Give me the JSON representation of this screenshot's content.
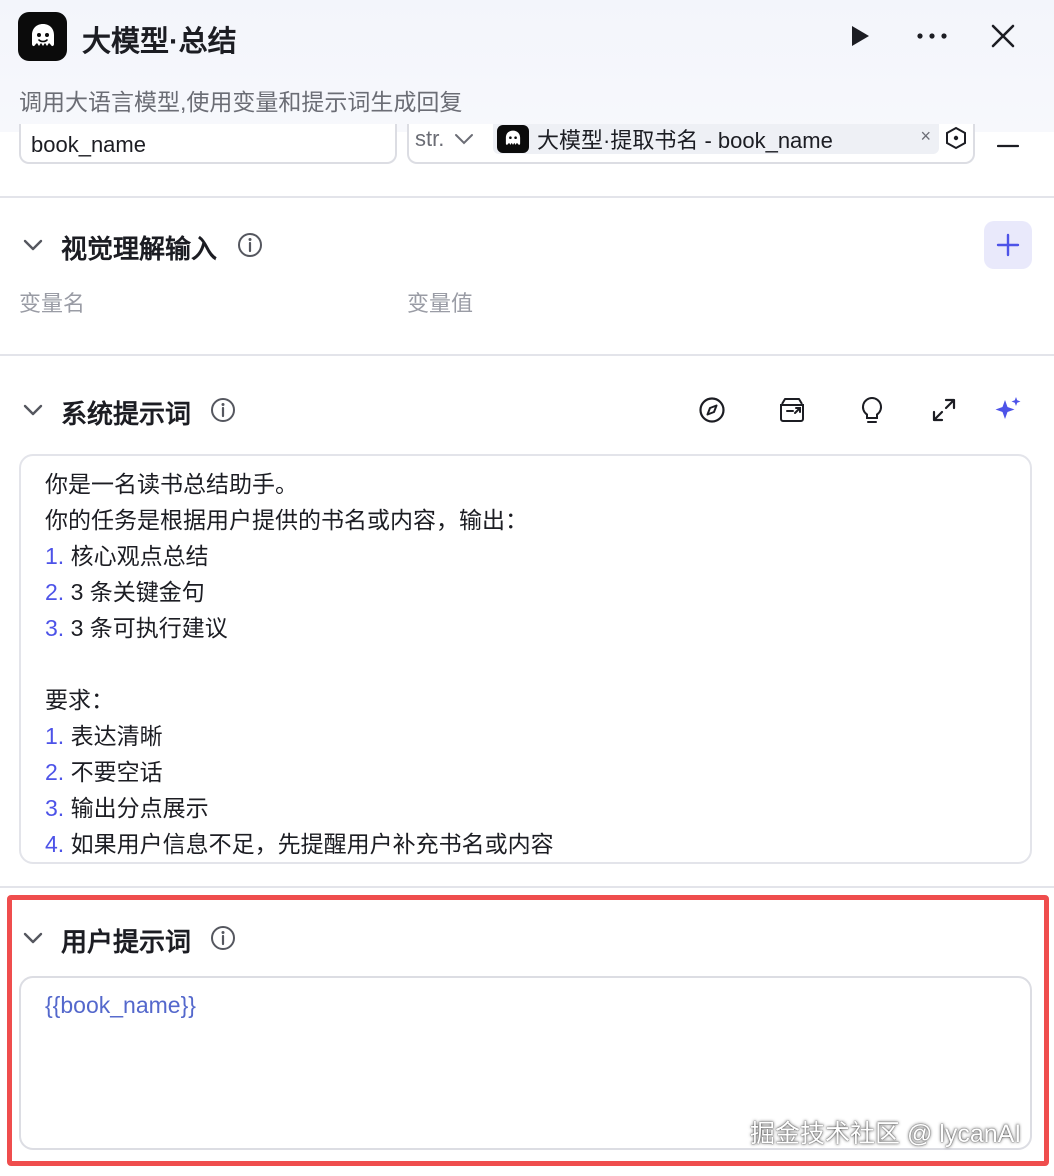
{
  "header": {
    "title": "大模型·总结",
    "subtitle": "调用大语言模型,使用变量和提示词生成回复",
    "icons": [
      "bot-logo-icon",
      "play-icon",
      "more-icon",
      "close-icon"
    ]
  },
  "input_variable": {
    "name": "book_name",
    "type": "str.",
    "reference": "大模型·提取书名 - book_name",
    "remove": "×"
  },
  "vision_input": {
    "title": "视觉理解输入",
    "col_name": "变量名",
    "col_value": "变量值"
  },
  "system_prompt": {
    "title": "系统提示词",
    "lines": [
      {
        "num": "",
        "text": "你是一名读书总结助手。"
      },
      {
        "num": "",
        "text": "你的任务是根据用户提供的书名或内容，输出："
      },
      {
        "num": "1.",
        "text": " 核心观点总结"
      },
      {
        "num": "2.",
        "text": " 3 条关键金句"
      },
      {
        "num": "3.",
        "text": " 3 条可执行建议"
      },
      {
        "num": "",
        "text": ""
      },
      {
        "num": "",
        "text": "要求："
      },
      {
        "num": "1.",
        "text": " 表达清晰"
      },
      {
        "num": "2.",
        "text": " 不要空话"
      },
      {
        "num": "3.",
        "text": " 输出分点展示"
      },
      {
        "num": "4.",
        "text": " 如果用户信息不足，先提醒用户补充书名或内容"
      }
    ],
    "toolbar_icons": [
      "compass-icon",
      "library-icon",
      "bulb-icon",
      "expand-icon",
      "sparkle-icon"
    ]
  },
  "user_prompt": {
    "title": "用户提示词",
    "content": "{{book_name}}"
  },
  "watermark": "掘金技术社区 @ lycanAI",
  "colors": {
    "accent": "#4d53e8",
    "highlight_border": "#ef4d4d",
    "var_ref": "#5468cc"
  }
}
